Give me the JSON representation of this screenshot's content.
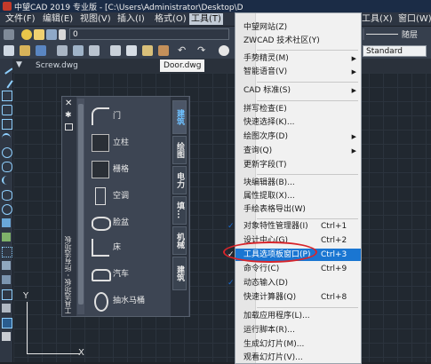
{
  "window": {
    "title": "中望CAD 2019 专业版 - [C:\\Users\\Administrator\\Desktop\\D"
  },
  "menubar": {
    "items": [
      {
        "label": "文件(F)"
      },
      {
        "label": "编辑(E)"
      },
      {
        "label": "视图(V)"
      },
      {
        "label": "插入(I)"
      },
      {
        "label": "格式(O)"
      },
      {
        "label": "工具(T)"
      },
      {
        "label": "工具(X)"
      },
      {
        "label": "窗口(W)"
      }
    ]
  },
  "toolbar": {
    "layer_value": "0",
    "bylayer_label": "随层",
    "textstyle_value": "Standard"
  },
  "tabs": [
    {
      "label": "Screw.dwg"
    },
    {
      "label": "Door.dwg"
    }
  ],
  "palette": {
    "title": "工具选项板 - 所有选项板",
    "items": [
      {
        "label": "门"
      },
      {
        "label": "立柱"
      },
      {
        "label": "栅格"
      },
      {
        "label": "空调"
      },
      {
        "label": "脸盆"
      },
      {
        "label": "床"
      },
      {
        "label": "汽车"
      },
      {
        "label": "抽水马桶"
      }
    ],
    "tabs": [
      {
        "label": "建筑"
      },
      {
        "label": "绘图"
      },
      {
        "label": "电力"
      },
      {
        "label": "填..."
      },
      {
        "label": "机械"
      },
      {
        "label": "建筑"
      }
    ]
  },
  "dropdown": {
    "items": [
      {
        "label": "中望网站(Z)"
      },
      {
        "label": "ZWCAD 技术社区(Y)"
      },
      {
        "label": "手势精灵(M)"
      },
      {
        "label": "智能语音(V)"
      },
      {
        "label": "CAD 标准(S)"
      },
      {
        "label": "拼写检查(E)"
      },
      {
        "label": "快速选择(K)..."
      },
      {
        "label": "绘图次序(D)"
      },
      {
        "label": "查询(Q)"
      },
      {
        "label": "更新字段(T)"
      },
      {
        "label": "块编辑器(B)..."
      },
      {
        "label": "属性提取(X)..."
      },
      {
        "label": "手绘表格导出(W)"
      },
      {
        "label": "对象特性管理器(I)",
        "shortcut": "Ctrl+1"
      },
      {
        "label": "设计中心(G)",
        "shortcut": "Ctrl+2"
      },
      {
        "label": "工具选项板窗口(P)",
        "shortcut": "Ctrl+3"
      },
      {
        "label": "命令行(C)",
        "shortcut": "Ctrl+9"
      },
      {
        "label": "动态输入(D)"
      },
      {
        "label": "快速计算器(Q)",
        "shortcut": "Ctrl+8"
      },
      {
        "label": "加载应用程序(L)..."
      },
      {
        "label": "运行脚本(R)..."
      },
      {
        "label": "生成幻灯片(M)..."
      },
      {
        "label": "观看幻灯片(V)..."
      }
    ]
  },
  "ucs": {
    "x_label": "X",
    "y_label": "Y"
  },
  "colors": {
    "highlight": "#1a76d2",
    "annotation": "#d8252b",
    "palette_active_tab": "#6ec0ff"
  },
  "icons": [
    "close-icon",
    "menu-icon",
    "door-icon",
    "column-icon",
    "grid-icon",
    "ac-icon",
    "basin-icon",
    "bed-icon",
    "car-icon",
    "toilet-icon",
    "checkmark-icon",
    "submenu-arrow-icon"
  ]
}
